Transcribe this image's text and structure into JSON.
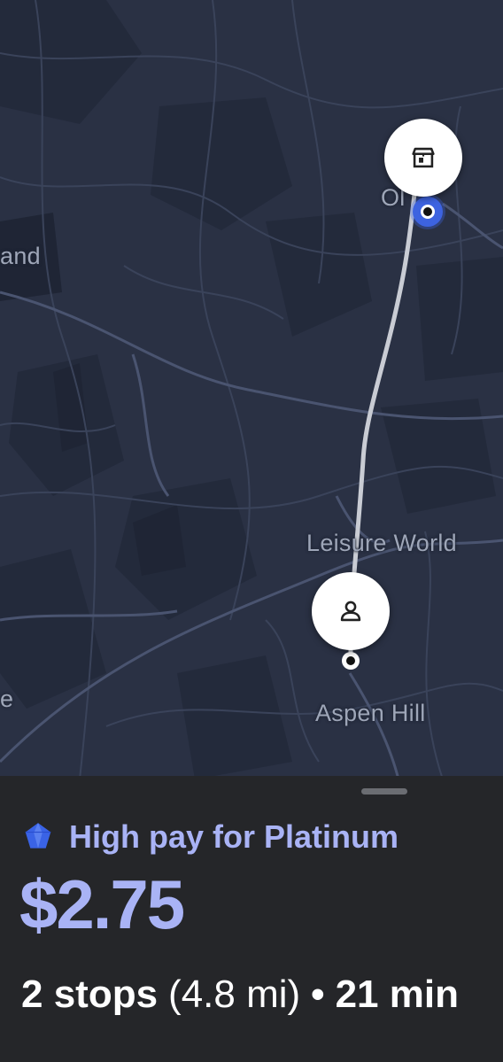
{
  "map": {
    "labels": {
      "top_right": "Ol",
      "left_mid": "and",
      "leisure_world": "Leisure World",
      "aspen_hill": "Aspen Hill",
      "left_bottom": "e"
    },
    "route_color": "#c9ccd4",
    "current_location_color": "#3d63e0",
    "pickup_icon": "store-icon",
    "dropoff_icon": "person-icon"
  },
  "offer": {
    "badge_icon": "diamond-icon",
    "badge_text": "High pay for Platinum",
    "price": "$2.75",
    "stops": "2 stops",
    "distance": "(4.8 mi)",
    "separator": "•",
    "duration": "21 min"
  },
  "colors": {
    "accent": "#a9b3f5",
    "diamond": "#3a63e6",
    "sheet_bg": "#252629",
    "map_bg": "#2a3144"
  }
}
